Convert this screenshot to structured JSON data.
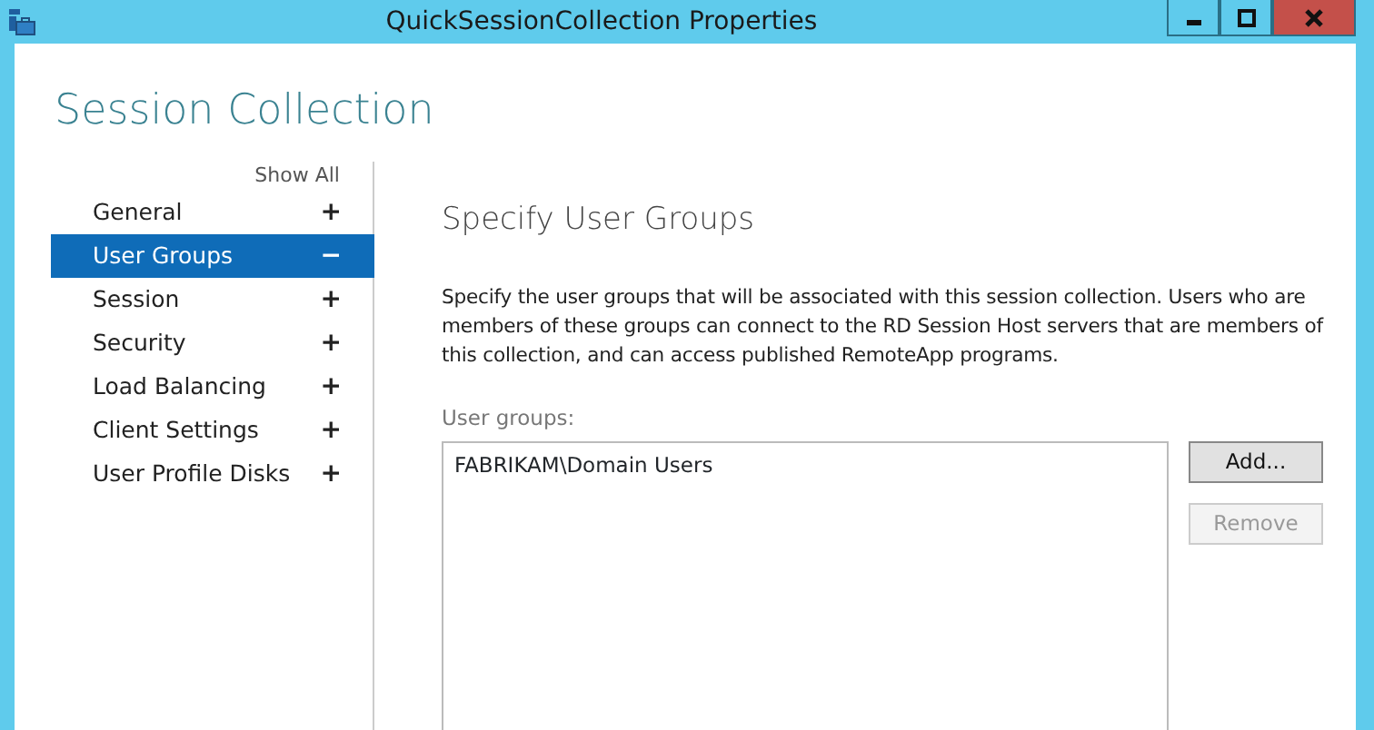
{
  "window": {
    "title": "QuickSessionCollection Properties"
  },
  "heading": "Session Collection",
  "show_all": "Show All",
  "sidebar": {
    "items": [
      {
        "label": "General",
        "toggle": "+",
        "selected": false
      },
      {
        "label": "User Groups",
        "toggle": "−",
        "selected": true
      },
      {
        "label": "Session",
        "toggle": "+",
        "selected": false
      },
      {
        "label": "Security",
        "toggle": "+",
        "selected": false
      },
      {
        "label": "Load Balancing",
        "toggle": "+",
        "selected": false
      },
      {
        "label": "Client Settings",
        "toggle": "+",
        "selected": false
      },
      {
        "label": "User Profile Disks",
        "toggle": "+",
        "selected": false
      }
    ]
  },
  "page": {
    "title": "Specify User Groups",
    "description": "Specify the user groups that will be associated with this session collection. Users who are members of these groups can connect to the RD Session Host servers that are members of this collection, and can access published RemoteApp programs.",
    "list_label": "User groups:",
    "groups": [
      "FABRIKAM\\Domain Users"
    ],
    "buttons": [
      {
        "label": "Add...",
        "disabled": false
      },
      {
        "label": "Remove",
        "disabled": true
      }
    ]
  }
}
